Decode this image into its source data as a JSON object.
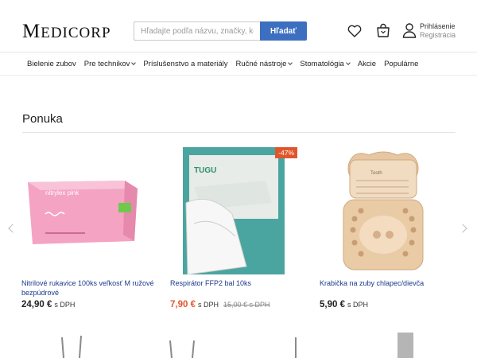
{
  "header": {
    "logo": "Medicorp",
    "search_placeholder": "Hľadajte podľa názvu, značky, kódu...",
    "search_button": "Hľadať",
    "icons": [
      "heart-icon",
      "cart-icon",
      "user-icon"
    ],
    "login": "Prihlásenie",
    "register": "Registrácia"
  },
  "nav": {
    "items": [
      {
        "label": "Bielenie zubov",
        "dropdown": false
      },
      {
        "label": "Pre technikov",
        "dropdown": true
      },
      {
        "label": "Príslušenstvo a materiály",
        "dropdown": false
      },
      {
        "label": "Ručné nástroje",
        "dropdown": true
      },
      {
        "label": "Stomatológia",
        "dropdown": true
      },
      {
        "label": "Akcie",
        "dropdown": false
      },
      {
        "label": "Populárne",
        "dropdown": false
      }
    ]
  },
  "section": {
    "title": "Ponuka"
  },
  "products": [
    {
      "name": "Nitrilové rukavice 100ks veľkosť M ružové bezpúdrové",
      "price": "24,90 €",
      "dph": "s DPH",
      "old_price": "",
      "badge": ""
    },
    {
      "name": "Respirátor FFP2 bal 10ks",
      "price": "7,90 €",
      "dph": "s DPH",
      "old_price": "15,00 € s DPH",
      "badge": "-47%"
    },
    {
      "name": "Krabička na zuby chlapec/dievča",
      "price": "5,90 €",
      "dph": "s DPH",
      "old_price": "",
      "badge": ""
    }
  ],
  "product_images": {
    "gloves_brand": "nitrylex pink",
    "mask_brand": "TUGU",
    "box_text": "Tooth"
  },
  "colors": {
    "accent": "#3d6fc0",
    "sale": "#e0562c",
    "link": "#1a3a8a"
  }
}
